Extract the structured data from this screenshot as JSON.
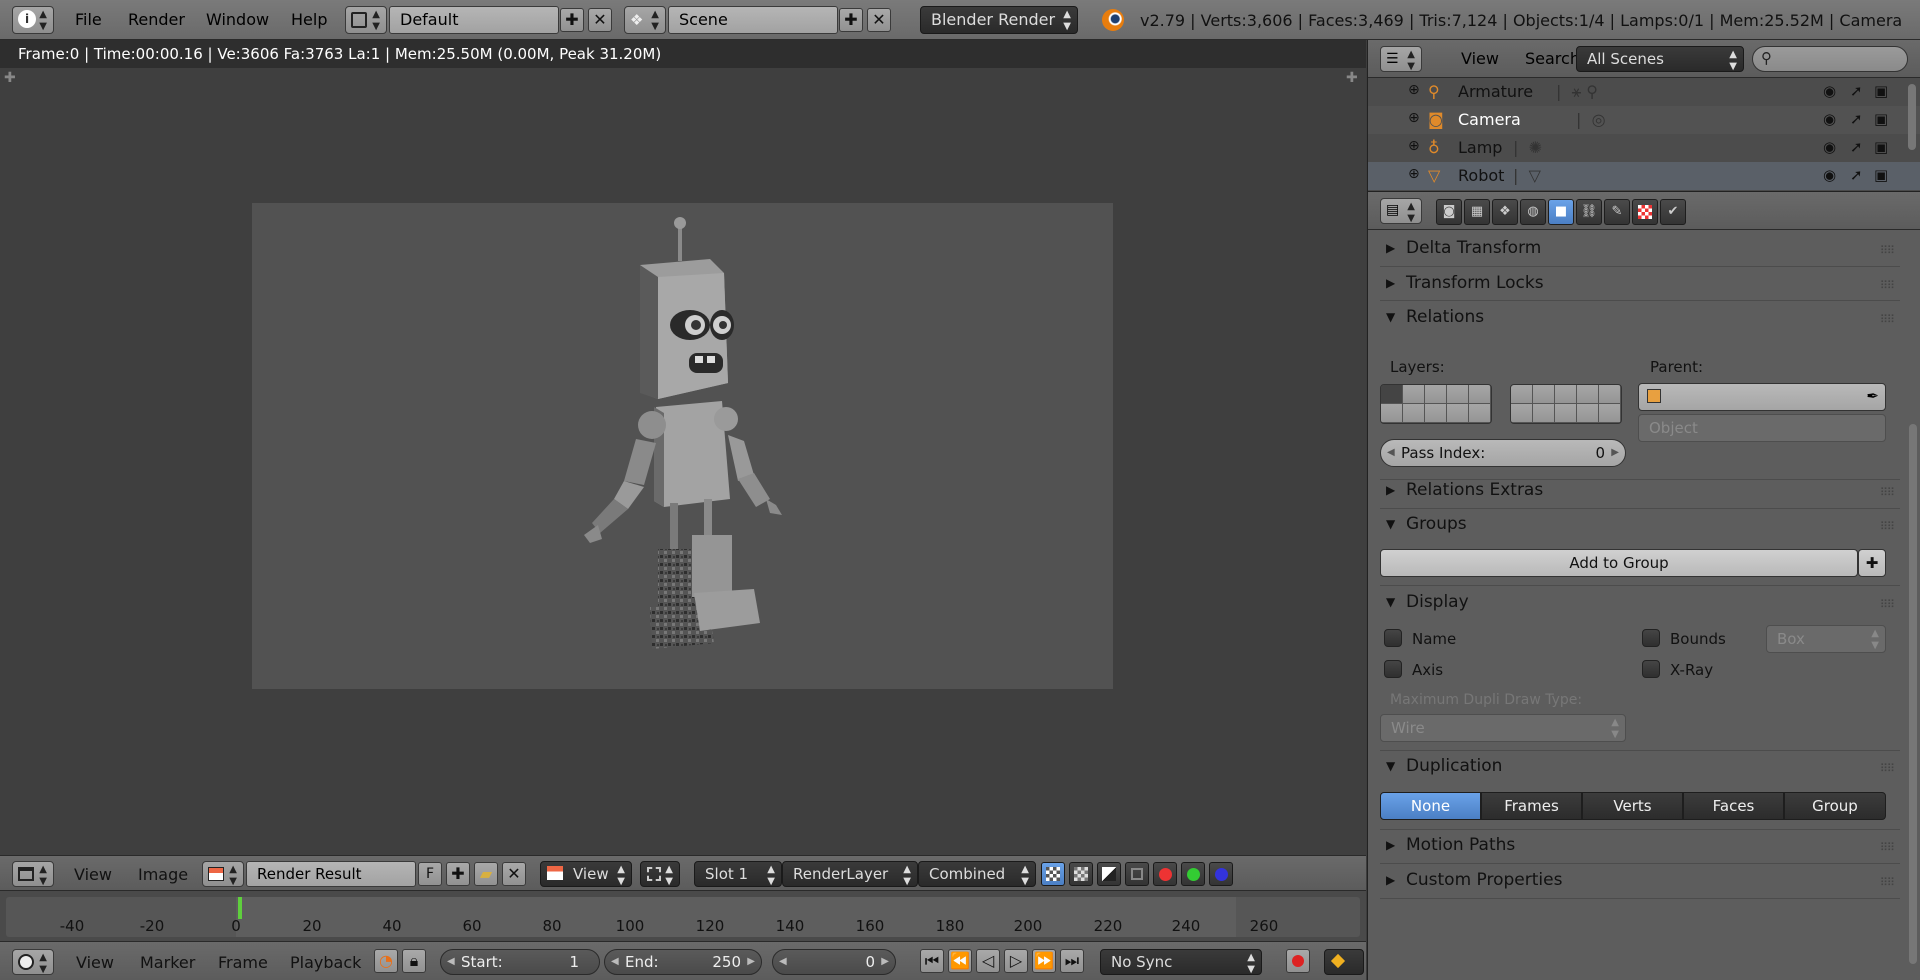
{
  "top_bar": {
    "menus": [
      "File",
      "Render",
      "Window",
      "Help"
    ],
    "layout_name": "Default",
    "scene_name": "Scene",
    "engine": "Blender Render",
    "stats": "v2.79 | Verts:3,606 | Faces:3,469 | Tris:7,124 | Objects:1/4 | Lamps:0/1 | Mem:25.52M | Camera"
  },
  "viewport": {
    "info": "Frame:0 | Time:00:00.16 | Ve:3606 Fa:3763 La:1 | Mem:25.50M (0.00M, Peak 31.20M)"
  },
  "image_header": {
    "menus": [
      "View",
      "Image"
    ],
    "image_name": "Render Result",
    "fake_user": "F",
    "view_mode": "View",
    "slot": "Slot 1",
    "render_layer": "RenderLayer",
    "pass": "Combined"
  },
  "timeline": {
    "ticks": [
      "-40",
      "-20",
      "0",
      "20",
      "40",
      "60",
      "80",
      "100",
      "120",
      "140",
      "160",
      "180",
      "200",
      "220",
      "240",
      "260"
    ],
    "current_frame_marker": 0
  },
  "timeline_header": {
    "menus": [
      "View",
      "Marker",
      "Frame",
      "Playback"
    ],
    "start_label": "Start:",
    "start_value": "1",
    "end_label": "End:",
    "end_value": "250",
    "current_value": "0",
    "sync": "No Sync"
  },
  "outliner": {
    "menus": [
      "View",
      "Search"
    ],
    "scene_filter": "All Scenes",
    "items": [
      {
        "label": "Armature",
        "icon": "armature-icon"
      },
      {
        "label": "Camera",
        "icon": "camera-icon"
      },
      {
        "label": "Lamp",
        "icon": "lamp-icon"
      },
      {
        "label": "Robot",
        "icon": "mesh-icon"
      }
    ]
  },
  "properties": {
    "panels": {
      "delta_transform": "Delta Transform",
      "transform_locks": "Transform Locks",
      "relations": "Relations",
      "relations_extras": "Relations Extras",
      "groups": "Groups",
      "display": "Display",
      "duplication": "Duplication",
      "motion_paths": "Motion Paths",
      "custom_properties": "Custom Properties"
    },
    "relations": {
      "layers_label": "Layers:",
      "parent_label": "Parent:",
      "parent_type": "Object",
      "pass_index_label": "Pass Index:",
      "pass_index_value": "0"
    },
    "groups": {
      "add_button": "Add to Group"
    },
    "display": {
      "name_label": "Name",
      "bounds_label": "Bounds",
      "bounds_type": "Box",
      "axis_label": "Axis",
      "xray_label": "X-Ray",
      "dupli_label": "Maximum Dupli Draw Type:",
      "dupli_value": "Wire"
    },
    "duplication": {
      "options": [
        "None",
        "Frames",
        "Verts",
        "Faces",
        "Group"
      ],
      "active": "None"
    }
  },
  "colors": {
    "accent": "#5b8fd6",
    "frame_marker": "#5fcf3d"
  }
}
